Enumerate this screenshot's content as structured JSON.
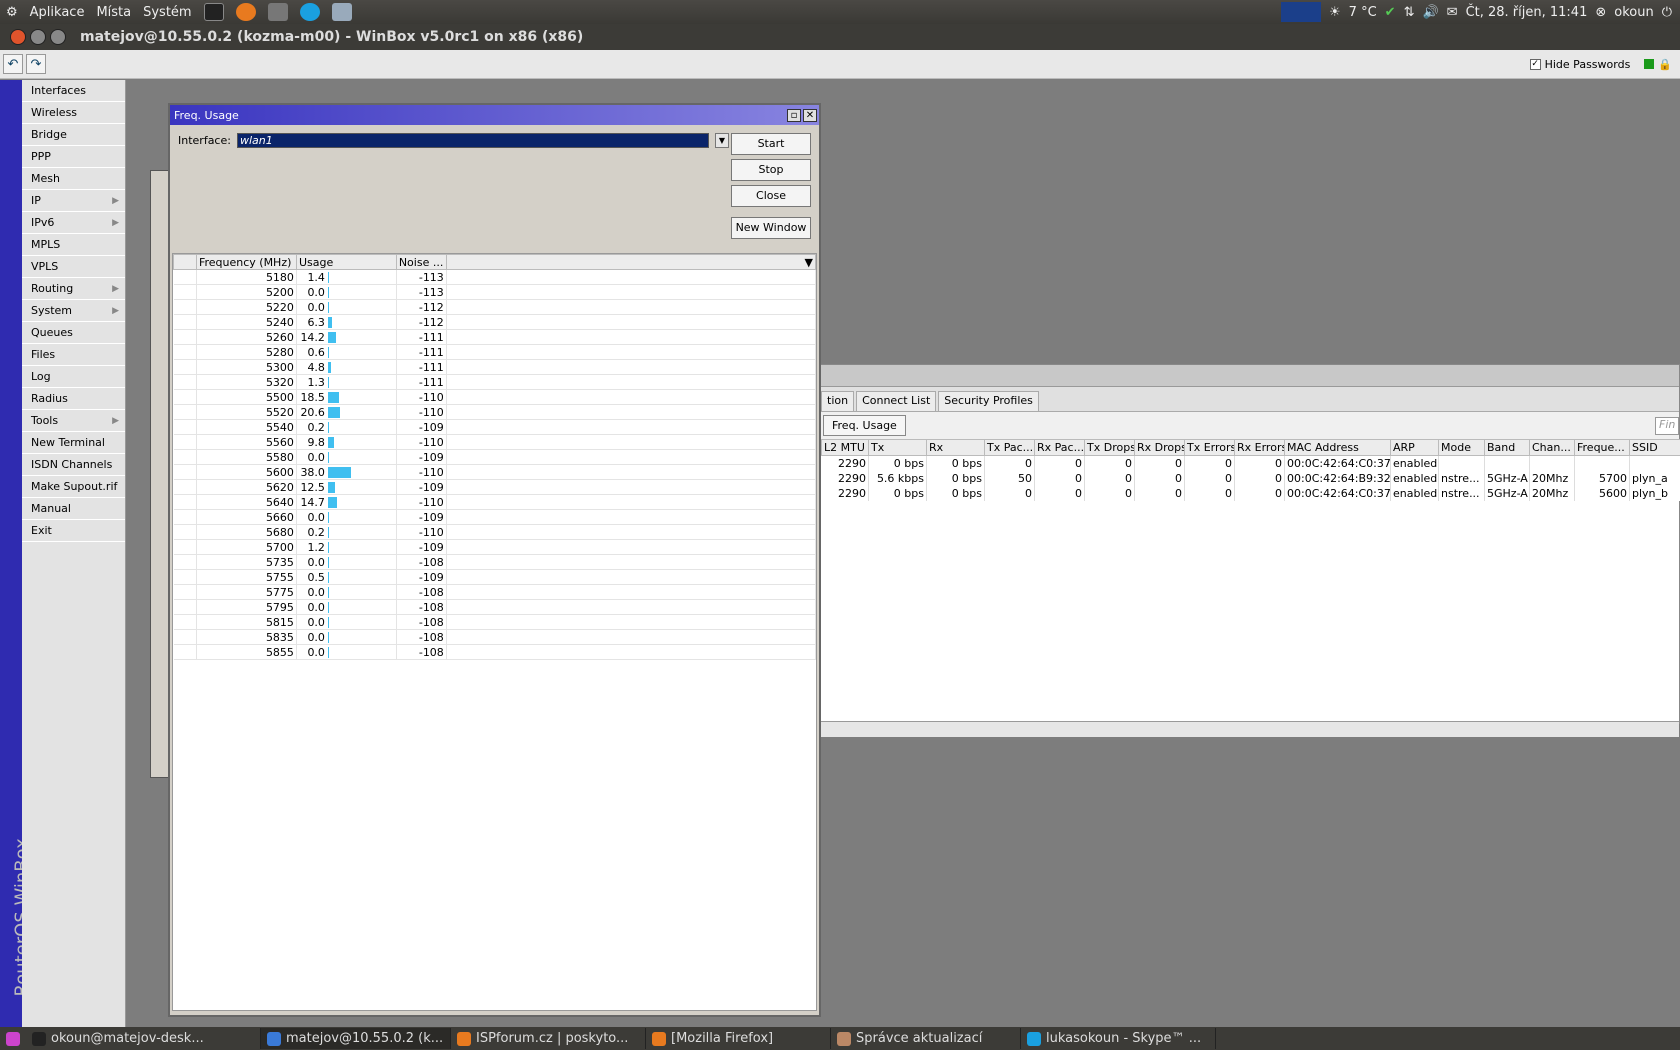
{
  "topbar": {
    "menus": [
      "Aplikace",
      "Místa",
      "Systém"
    ],
    "weather": "7 °C",
    "datetime": "Čt, 28. říjen, 11:41",
    "user": "okoun"
  },
  "window": {
    "title": "matejov@10.55.0.2 (kozma-m00) - WinBox v5.0rc1 on x86 (x86)"
  },
  "toolbar": {
    "hide_passwords": "Hide Passwords"
  },
  "sidebar": {
    "brand": "RouterOS WinBox",
    "items": [
      {
        "label": "Interfaces",
        "sub": false
      },
      {
        "label": "Wireless",
        "sub": false
      },
      {
        "label": "Bridge",
        "sub": false
      },
      {
        "label": "PPP",
        "sub": false
      },
      {
        "label": "Mesh",
        "sub": false
      },
      {
        "label": "IP",
        "sub": true
      },
      {
        "label": "IPv6",
        "sub": true
      },
      {
        "label": "MPLS",
        "sub": false
      },
      {
        "label": "VPLS",
        "sub": false
      },
      {
        "label": "Routing",
        "sub": true
      },
      {
        "label": "System",
        "sub": true
      },
      {
        "label": "Queues",
        "sub": false
      },
      {
        "label": "Files",
        "sub": false
      },
      {
        "label": "Log",
        "sub": false
      },
      {
        "label": "Radius",
        "sub": false
      },
      {
        "label": "Tools",
        "sub": true
      },
      {
        "label": "New Terminal",
        "sub": false
      },
      {
        "label": "ISDN Channels",
        "sub": false
      },
      {
        "label": "Make Supout.rif",
        "sub": false
      },
      {
        "label": "Manual",
        "sub": false
      },
      {
        "label": "Exit",
        "sub": false
      }
    ]
  },
  "freq": {
    "title": "Freq. Usage",
    "interface_label": "Interface:",
    "interface_value": "wlan1",
    "buttons": {
      "start": "Start",
      "stop": "Stop",
      "close": "Close",
      "new_window": "New Window"
    },
    "columns": [
      "Frequency (MHz)",
      "Usage",
      "Noise ..."
    ],
    "rows": [
      {
        "f": "5180",
        "u": "1.4",
        "n": "-113"
      },
      {
        "f": "5200",
        "u": "0.0",
        "n": "-113"
      },
      {
        "f": "5220",
        "u": "0.0",
        "n": "-112"
      },
      {
        "f": "5240",
        "u": "6.3",
        "n": "-112"
      },
      {
        "f": "5260",
        "u": "14.2",
        "n": "-111"
      },
      {
        "f": "5280",
        "u": "0.6",
        "n": "-111"
      },
      {
        "f": "5300",
        "u": "4.8",
        "n": "-111"
      },
      {
        "f": "5320",
        "u": "1.3",
        "n": "-111"
      },
      {
        "f": "5500",
        "u": "18.5",
        "n": "-110"
      },
      {
        "f": "5520",
        "u": "20.6",
        "n": "-110"
      },
      {
        "f": "5540",
        "u": "0.2",
        "n": "-109"
      },
      {
        "f": "5560",
        "u": "9.8",
        "n": "-110"
      },
      {
        "f": "5580",
        "u": "0.0",
        "n": "-109"
      },
      {
        "f": "5600",
        "u": "38.0",
        "n": "-110"
      },
      {
        "f": "5620",
        "u": "12.5",
        "n": "-109"
      },
      {
        "f": "5640",
        "u": "14.7",
        "n": "-110"
      },
      {
        "f": "5660",
        "u": "0.0",
        "n": "-109"
      },
      {
        "f": "5680",
        "u": "0.2",
        "n": "-110"
      },
      {
        "f": "5700",
        "u": "1.2",
        "n": "-109"
      },
      {
        "f": "5735",
        "u": "0.0",
        "n": "-108"
      },
      {
        "f": "5755",
        "u": "0.5",
        "n": "-109"
      },
      {
        "f": "5775",
        "u": "0.0",
        "n": "-108"
      },
      {
        "f": "5795",
        "u": "0.0",
        "n": "-108"
      },
      {
        "f": "5815",
        "u": "0.0",
        "n": "-108"
      },
      {
        "f": "5835",
        "u": "0.0",
        "n": "-108"
      },
      {
        "f": "5855",
        "u": "0.0",
        "n": "-108"
      }
    ]
  },
  "wireless": {
    "tabs": [
      "tion",
      "Connect List",
      "Security Profiles"
    ],
    "freq_button": "Freq. Usage",
    "find": "Fin",
    "columns": [
      "L2 MTU",
      "Tx",
      "Rx",
      "Tx Pac...",
      "Rx Pac...",
      "Tx Drops",
      "Rx Drops",
      "Tx Errors",
      "Rx Errors",
      "MAC Address",
      "ARP",
      "Mode",
      "Band",
      "Chan...",
      "Freque...",
      "SSID"
    ],
    "rows": [
      [
        "2290",
        "0 bps",
        "0 bps",
        "0",
        "0",
        "0",
        "0",
        "0",
        "0",
        "00:0C:42:64:C0:37",
        "enabled",
        "",
        "",
        "",
        "",
        ""
      ],
      [
        "2290",
        "5.6 kbps",
        "0 bps",
        "50",
        "0",
        "0",
        "0",
        "0",
        "0",
        "00:0C:42:64:B9:32",
        "enabled",
        "nstre...",
        "5GHz-A",
        "20Mhz",
        "5700",
        "plyn_a"
      ],
      [
        "2290",
        "0 bps",
        "0 bps",
        "0",
        "0",
        "0",
        "0",
        "0",
        "0",
        "00:0C:42:64:C0:37",
        "enabled",
        "nstre...",
        "5GHz-A",
        "20Mhz",
        "5600",
        "plyn_b"
      ]
    ]
  },
  "taskbar": {
    "tasks": [
      "okoun@matejov-desk...",
      "matejov@10.55.0.2 (k...",
      "ISPforum.cz | poskyto...",
      "[Mozilla Firefox]",
      "Správce aktualizací",
      "lukasokoun - Skype™ ..."
    ]
  }
}
